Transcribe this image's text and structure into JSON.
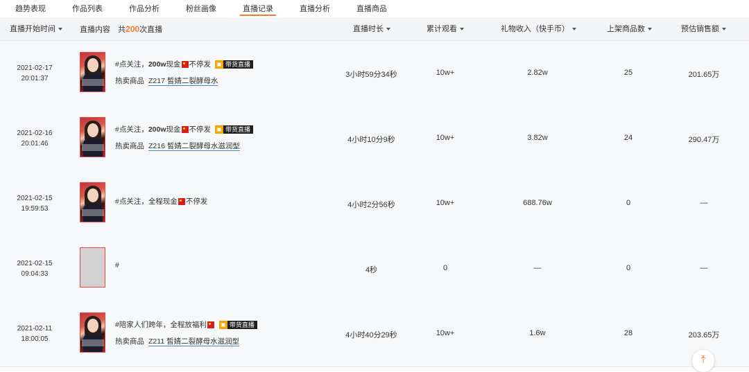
{
  "tabs": [
    "趋势表现",
    "作品列表",
    "作品分析",
    "粉丝画像",
    "直播记录",
    "直播分析",
    "直播商品"
  ],
  "active_tab": 4,
  "header": {
    "start_time": "直播开始时间",
    "content": "直播内容",
    "count_prefix": "共",
    "count_num": "200",
    "count_suffix": "次直播",
    "duration": "直播时长",
    "viewers": "累计观看",
    "gifts": "礼物收入（快手币）",
    "goods": "上架商品数",
    "sales": "预估销售额"
  },
  "badge_label": "带货直播",
  "hot_label": "热卖商品",
  "rows": [
    {
      "date": "2021-02-17",
      "time": "20:01:37",
      "t1": "#点关注，",
      "t2": "200w",
      "t3": "现金",
      "t4": "不停发",
      "badge": true,
      "product": "Z217 皙婧二裂酵母水",
      "duration": "3小时59分34秒",
      "viewers": "10w+",
      "gifts": "2.82w",
      "goods": "25",
      "sales": "201.65万"
    },
    {
      "date": "2021-02-16",
      "time": "20:01:46",
      "t1": "#点关注，",
      "t2": "200w",
      "t3": "现金",
      "t4": "不停发",
      "badge": true,
      "product": "Z216 皙婧二裂酵母水滋润型",
      "duration": "4小时10分9秒",
      "viewers": "10w+",
      "gifts": "3.82w",
      "goods": "24",
      "sales": "290.47万"
    },
    {
      "date": "2021-02-15",
      "time": "19:59:53",
      "t1": "#点关注，全程现金",
      "t2": "",
      "t3": "",
      "t4": "不停发",
      "badge": false,
      "product": "",
      "duration": "4小时2分56秒",
      "viewers": "10w+",
      "gifts": "688.76w",
      "goods": "0",
      "sales": "—"
    },
    {
      "date": "2021-02-15",
      "time": "09:04:33",
      "t1": "#",
      "t2": "",
      "t3": "",
      "t4": "",
      "badge": false,
      "product": "",
      "duration": "4秒",
      "viewers": "0",
      "gifts": "—",
      "goods": "0",
      "sales": "—"
    },
    {
      "date": "2021-02-11",
      "time": "18:00:05",
      "t1": "#陪家人们跨年，全程放福利",
      "t2": "",
      "t3": "",
      "t4": "",
      "badge": true,
      "product": "Z211 皙婧二裂酵母水滋润型",
      "duration": "4小时40分29秒",
      "viewers": "10w+",
      "gifts": "1.6w",
      "goods": "28",
      "sales": "203.65万"
    }
  ],
  "icons": {
    "sort": "caret-down-icon",
    "top": "back-to-top-icon",
    "flag": "red-envelope-icon",
    "cart": "cart-icon"
  },
  "colors": {
    "accent": "#f57c2a",
    "header_bg": "#f4f5f7",
    "row_bg": "#f7f8fa"
  },
  "back_to_top": "⤒"
}
